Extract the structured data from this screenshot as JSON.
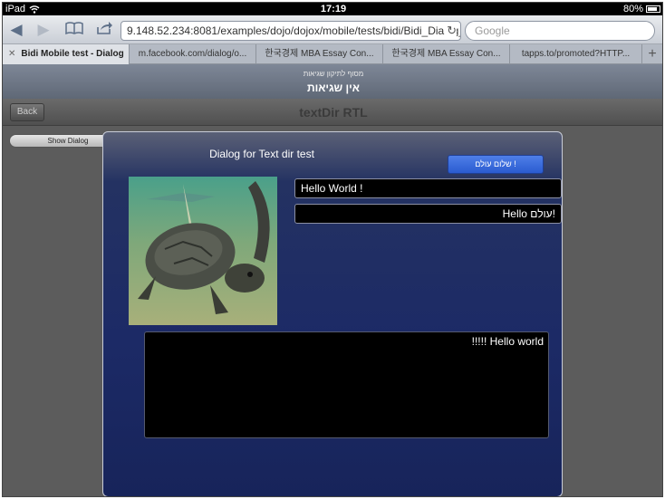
{
  "status_bar": {
    "device": "iPad",
    "time": "17:19",
    "battery": "80%"
  },
  "browser": {
    "url": "9.148.52.234:8081/examples/dojo/dojox/mobile/tests/bidi/Bidi_Dialog_1.h",
    "search_placeholder": "Google",
    "tabs": [
      {
        "label": "Bidi Mobile test - Dialog",
        "active": true
      },
      {
        "label": "m.facebook.com/dialog/o...",
        "active": false
      },
      {
        "label": "한국경제 MBA Essay Con...",
        "active": false
      },
      {
        "label": "한국경제 MBA Essay Con...",
        "active": false
      },
      {
        "label": "tapps.to/promoted?HTTP...",
        "active": false
      }
    ]
  },
  "page_header": {
    "subtitle": "מסוף לתיקון שגיאות",
    "title": "אין שגיאות"
  },
  "heading": {
    "back_label": "Back",
    "title": "textDir RTL"
  },
  "show_dialog_label": "Show Dialog",
  "dialog": {
    "title": "Dialog for Text dir test",
    "button_label": "שלום עולם !",
    "field1_value": "Hello World !",
    "field2_value": "Hello עולם!",
    "textarea_value": "!!!!! Hello world"
  },
  "colors": {
    "dialog_bg": "#1c2a66",
    "button_blue": "#2a5bd0",
    "heading_gray": "#5f6876"
  }
}
